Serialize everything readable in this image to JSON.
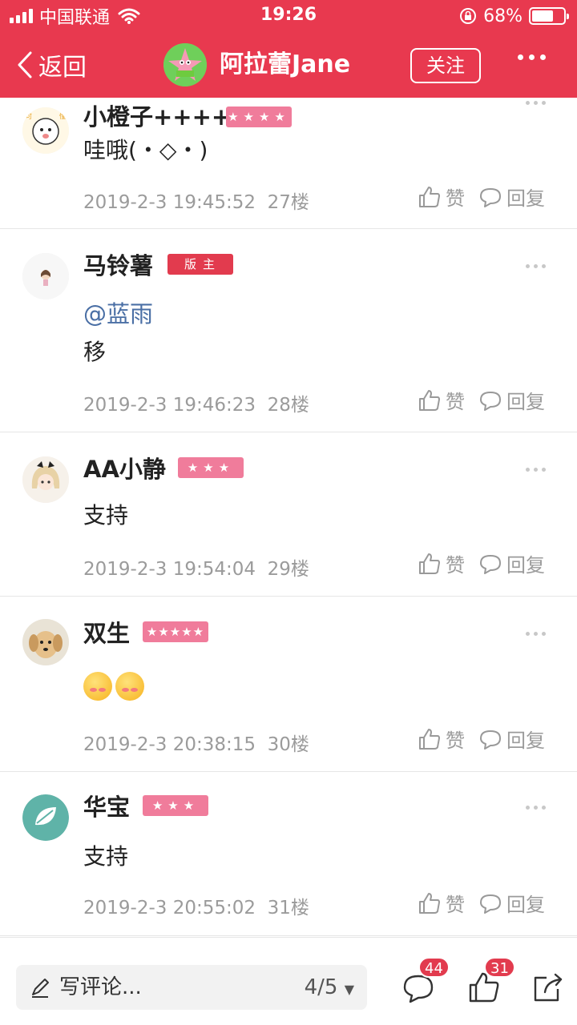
{
  "status_bar": {
    "carrier": "中国联通",
    "time": "19:26",
    "battery": "68%",
    "battery_level": 0.68
  },
  "header": {
    "back_label": "返回",
    "title": "阿拉蕾Jane",
    "follow_label": "关注"
  },
  "comments": [
    {
      "name": "小橙子++++",
      "badge": "★★★★",
      "text": "哇哦(・◇・)",
      "time": "2019-2-3 19:45:52",
      "floor": "27楼"
    },
    {
      "name": "马铃薯",
      "badge": "版主",
      "mention": "@蓝雨",
      "text": "移",
      "time": "2019-2-3 19:46:23",
      "floor": "28楼"
    },
    {
      "name": "AA小静",
      "badge": "★★★",
      "text": "支持",
      "time": "2019-2-3 19:54:04",
      "floor": "29楼"
    },
    {
      "name": "双生",
      "badge": "★★★★★",
      "time": "2019-2-3 20:38:15",
      "floor": "30楼"
    },
    {
      "name": "华宝",
      "badge": "★★★",
      "text": "支持",
      "time": "2019-2-3 20:55:02",
      "floor": "31楼"
    }
  ],
  "actions": {
    "like": "赞",
    "reply": "回复"
  },
  "bottom_bar": {
    "write_placeholder": "写评论...",
    "page_indicator": "4/5",
    "comment_count": "44",
    "like_count": "31"
  },
  "colors": {
    "brand": "#e8394f",
    "moderator_badge": "#e23b4e",
    "level_badge": "#f07c9b",
    "mention": "#4a6fa5"
  }
}
